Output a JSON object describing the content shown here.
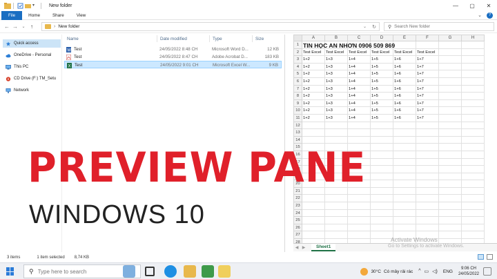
{
  "window": {
    "title": "New folder",
    "controls": [
      "—",
      "▢",
      "✕"
    ]
  },
  "ribbon": {
    "tabs": [
      "File",
      "Home",
      "Share",
      "View"
    ],
    "expand_icon": "chevron-down-icon",
    "help_icon": "help-icon"
  },
  "address": {
    "path": "New folder",
    "search_placeholder": "Search New folder"
  },
  "navigation": {
    "items": [
      {
        "label": "Quick access",
        "icon": "star-icon"
      },
      {
        "label": "OneDrive - Personal",
        "icon": "cloud-icon"
      },
      {
        "label": "This PC",
        "icon": "computer-icon"
      },
      {
        "label": "CD Drive (F:) TM_Setu",
        "icon": "cd-drive-icon"
      },
      {
        "label": "Network",
        "icon": "network-icon"
      }
    ]
  },
  "files": {
    "columns": [
      "Name",
      "Date modified",
      "Type",
      "Size"
    ],
    "rows": [
      {
        "name": "Test",
        "date": "24/05/2022 8:48 CH",
        "type": "Microsoft Word D...",
        "size": "12 KB",
        "icon": "word-file-icon"
      },
      {
        "name": "Test",
        "date": "24/05/2022 8:47 CH",
        "type": "Adobe Acrobat D...",
        "size": "183 KB",
        "icon": "pdf-file-icon"
      },
      {
        "name": "Test",
        "date": "24/05/2022 9:01 CH",
        "type": "Microsoft Excel W...",
        "size": "9 KB",
        "icon": "excel-file-icon"
      }
    ]
  },
  "preview": {
    "columns": [
      "A",
      "B",
      "C",
      "D",
      "E",
      "F",
      "G",
      "H"
    ],
    "title_row": "TIN HỌC AN NHƠN 0906 509 869",
    "header_row": [
      "Test Excel",
      "Test Excel",
      "Test Excel",
      "Test Excel",
      "Test Excel",
      "Test Excel"
    ],
    "data_row": [
      "1+2",
      "1+3",
      "1+4",
      "1+5",
      "1+6",
      "1+7"
    ],
    "data_row_count": 9,
    "row_count": 28,
    "sheet_tab": "Sheet1"
  },
  "overlay": {
    "title": "PREVIEW PANE",
    "subtitle": "WINDOWS 10"
  },
  "watermark": {
    "line1": "Activate Windows",
    "line2": "Go to Settings to activate Windows."
  },
  "status": {
    "items": "3 items",
    "selected": "1 item selected",
    "size": "8,74 KB"
  },
  "taskbar": {
    "search_placeholder": "Type here to search",
    "temperature": "30°C",
    "weather": "Có mây rải rác",
    "language": "ENG",
    "time": "9:06 CH",
    "date": "24/05/2022"
  },
  "colors": {
    "accent": "#1a6ec2",
    "overlay_red": "#e0202a",
    "excel_green": "#1e7145",
    "selection": "#cce8ff"
  }
}
